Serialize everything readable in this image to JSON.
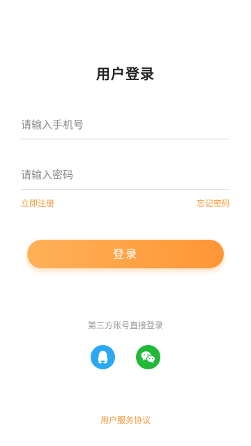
{
  "page": {
    "title": "用户登录"
  },
  "form": {
    "phone_placeholder": "请输入手机号",
    "phone_value": "",
    "password_placeholder": "请输入密码",
    "password_value": ""
  },
  "links": {
    "register": "立即注册",
    "forgot_password": "忘记密码"
  },
  "login_button": {
    "label": "登录"
  },
  "third_party": {
    "label": "第三方账号直接登录",
    "providers": [
      {
        "name": "qq",
        "icon": "qq-icon",
        "color": "#2aa8f2"
      },
      {
        "name": "wechat",
        "icon": "wechat-icon",
        "color": "#22b838"
      }
    ]
  },
  "footer": {
    "agreement": "用户服务协议"
  },
  "colors": {
    "accent": "#f29a3a",
    "button_gradient_start": "#ffb15a",
    "button_gradient_end": "#ff9635"
  }
}
